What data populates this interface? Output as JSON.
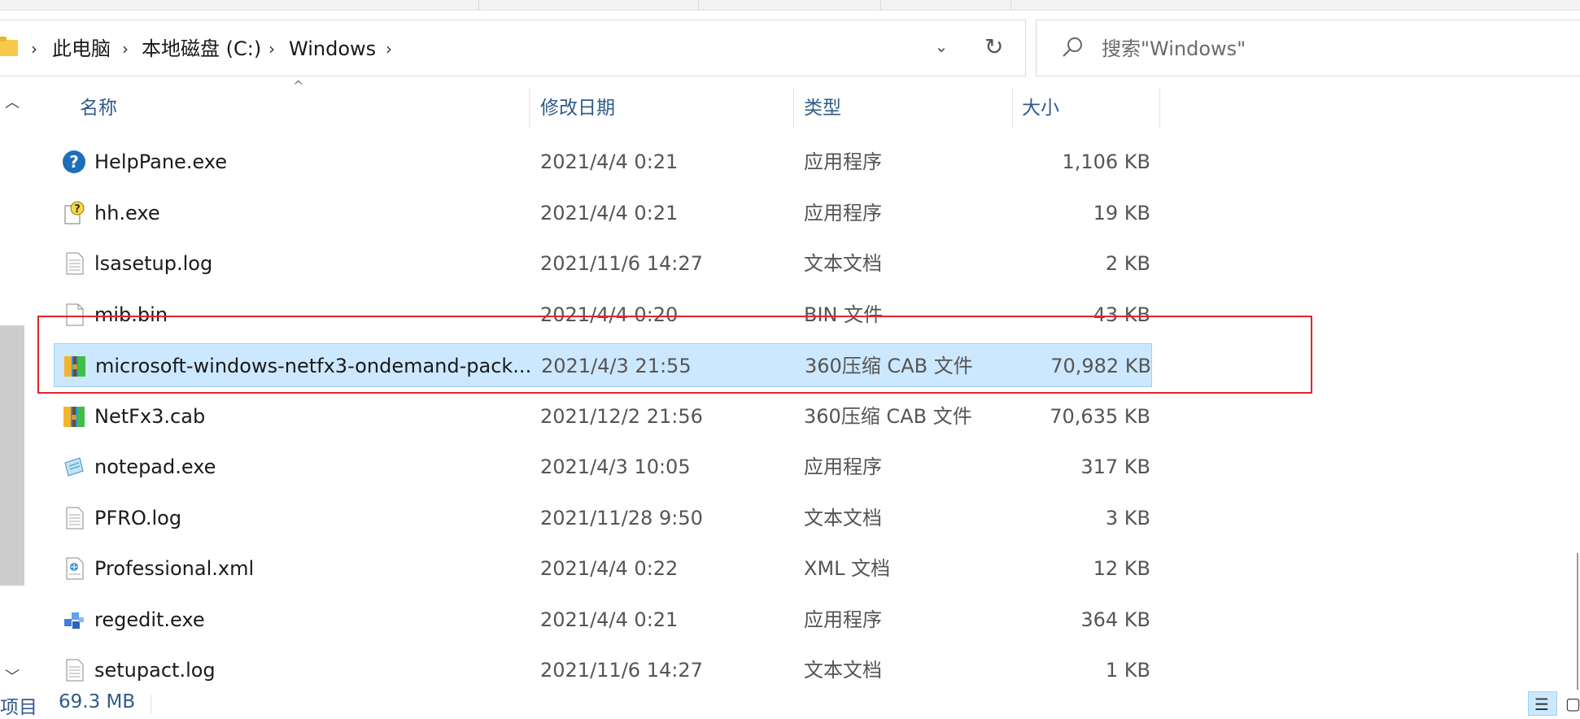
{
  "address_bar": {
    "breadcrumbs": [
      "此电脑",
      "本地磁盘 (C:)",
      "Windows"
    ],
    "dropdown_icon": "chevron-down-icon",
    "refresh_icon": "refresh-icon"
  },
  "search": {
    "placeholder": "搜索\"Windows\""
  },
  "columns": {
    "name": "名称",
    "date": "修改日期",
    "type": "类型",
    "size": "大小"
  },
  "files": [
    {
      "name": "HelpPane.exe",
      "date": "2021/4/4 0:21",
      "type": "应用程序",
      "size": "1,106 KB",
      "icon": "help-icon"
    },
    {
      "name": "hh.exe",
      "date": "2021/4/4 0:21",
      "type": "应用程序",
      "size": "19 KB",
      "icon": "help-document-icon"
    },
    {
      "name": "lsasetup.log",
      "date": "2021/11/6 14:27",
      "type": "文本文档",
      "size": "2 KB",
      "icon": "text-file-icon"
    },
    {
      "name": "mib.bin",
      "date": "2021/4/4 0:20",
      "type": "BIN 文件",
      "size": "43 KB",
      "icon": "blank-file-icon"
    },
    {
      "name": "microsoft-windows-netfx3-ondemand-pack...",
      "date": "2021/4/3 21:55",
      "type": "360压缩 CAB 文件",
      "size": "70,982 KB",
      "icon": "archive-icon",
      "selected": true
    },
    {
      "name": "NetFx3.cab",
      "date": "2021/12/2 21:56",
      "type": "360压缩 CAB 文件",
      "size": "70,635 KB",
      "icon": "archive-icon"
    },
    {
      "name": "notepad.exe",
      "date": "2021/4/3 10:05",
      "type": "应用程序",
      "size": "317 KB",
      "icon": "notepad-icon"
    },
    {
      "name": "PFRO.log",
      "date": "2021/11/28 9:50",
      "type": "文本文档",
      "size": "3 KB",
      "icon": "text-file-icon"
    },
    {
      "name": "Professional.xml",
      "date": "2021/4/4 0:22",
      "type": "XML 文档",
      "size": "12 KB",
      "icon": "xml-file-icon"
    },
    {
      "name": "regedit.exe",
      "date": "2021/4/4 0:21",
      "type": "应用程序",
      "size": "364 KB",
      "icon": "registry-icon"
    },
    {
      "name": "setupact.log",
      "date": "2021/11/6 14:27",
      "type": "文本文档",
      "size": "1 KB",
      "icon": "text-file-icon"
    }
  ],
  "status_bar": {
    "items_label": "项目",
    "selected_size": "69.3 MB"
  },
  "colors": {
    "selection_bg": "#cce8ff",
    "selection_border": "#99d1ff",
    "highlight_box": "#e0262b",
    "header_text": "#2f5b8a"
  }
}
